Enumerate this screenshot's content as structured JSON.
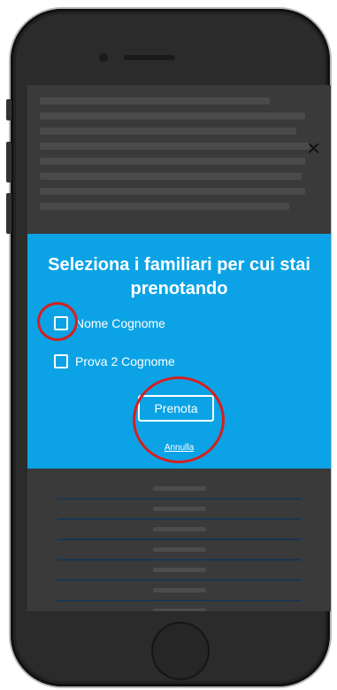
{
  "modal": {
    "title": "Seleziona i familiari per cui stai prenotando",
    "options": [
      {
        "label": "Nome Cognome",
        "checked": false
      },
      {
        "label": "Prova 2 Cognome",
        "checked": false
      }
    ],
    "confirm_label": "Prenota",
    "cancel_label": "Annulla",
    "background_color": "#0ba3e6"
  },
  "close": {
    "icon": "close-icon",
    "glyph": "×"
  },
  "annotations": {
    "color": "#d42020"
  }
}
